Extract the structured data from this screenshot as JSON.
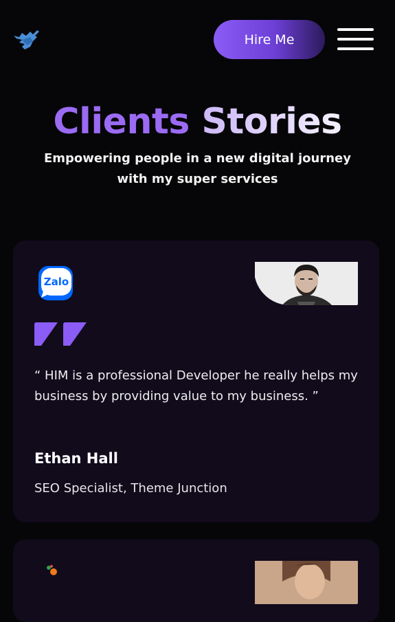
{
  "header": {
    "logo_icon": "bird-logo-icon",
    "hire_label": "Hire Me",
    "menu_icon": "hamburger-menu-icon"
  },
  "section": {
    "title_part1": "Clients",
    "title_part2": "Stories",
    "subtitle": "Empowering people in a new digital journey with my super services"
  },
  "testimonials": [
    {
      "brand_label": "Zalo",
      "brand_icon": "zalo-logo-icon",
      "photo": "client-photo",
      "quote": "“ HIM is a professional Developer he really helps my business by providing value to my business. ”",
      "name": "Ethan Hall",
      "role": "SEO Specialist, Theme Junction"
    },
    {
      "brand_icon": "brand-logo-icon",
      "photo": "client-photo"
    }
  ],
  "colors": {
    "background": "#060608",
    "card": "#120b1c",
    "accent": "#8b5cf6",
    "logo_blue": "#4a8fd6"
  }
}
